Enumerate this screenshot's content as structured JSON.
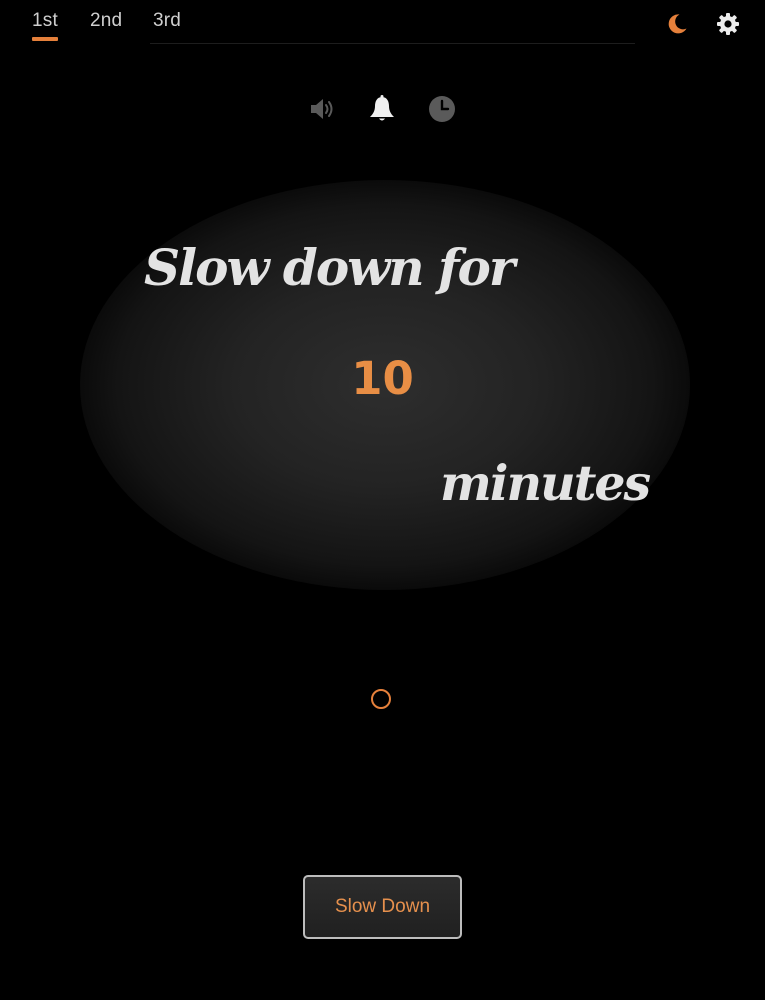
{
  "tabs": [
    {
      "label": "1st",
      "active": true
    },
    {
      "label": "2nd",
      "active": false
    },
    {
      "label": "3rd",
      "active": false
    }
  ],
  "toolbar": {
    "night_mode_icon": "moon-icon",
    "settings_icon": "gear-icon"
  },
  "alert_modes": [
    {
      "icon": "speaker-icon",
      "active": false
    },
    {
      "icon": "bell-icon",
      "active": true
    },
    {
      "icon": "clock-icon",
      "active": false
    }
  ],
  "prompt": {
    "prefix": "Slow down for",
    "value": "10",
    "suffix": "minutes"
  },
  "progress": {
    "value": 0
  },
  "action_button": {
    "label": "Slow Down"
  },
  "colors": {
    "accent": "#e5803b",
    "text": "#e3e3e3",
    "background": "#000000",
    "inactive_icon": "#5a5a5a"
  }
}
